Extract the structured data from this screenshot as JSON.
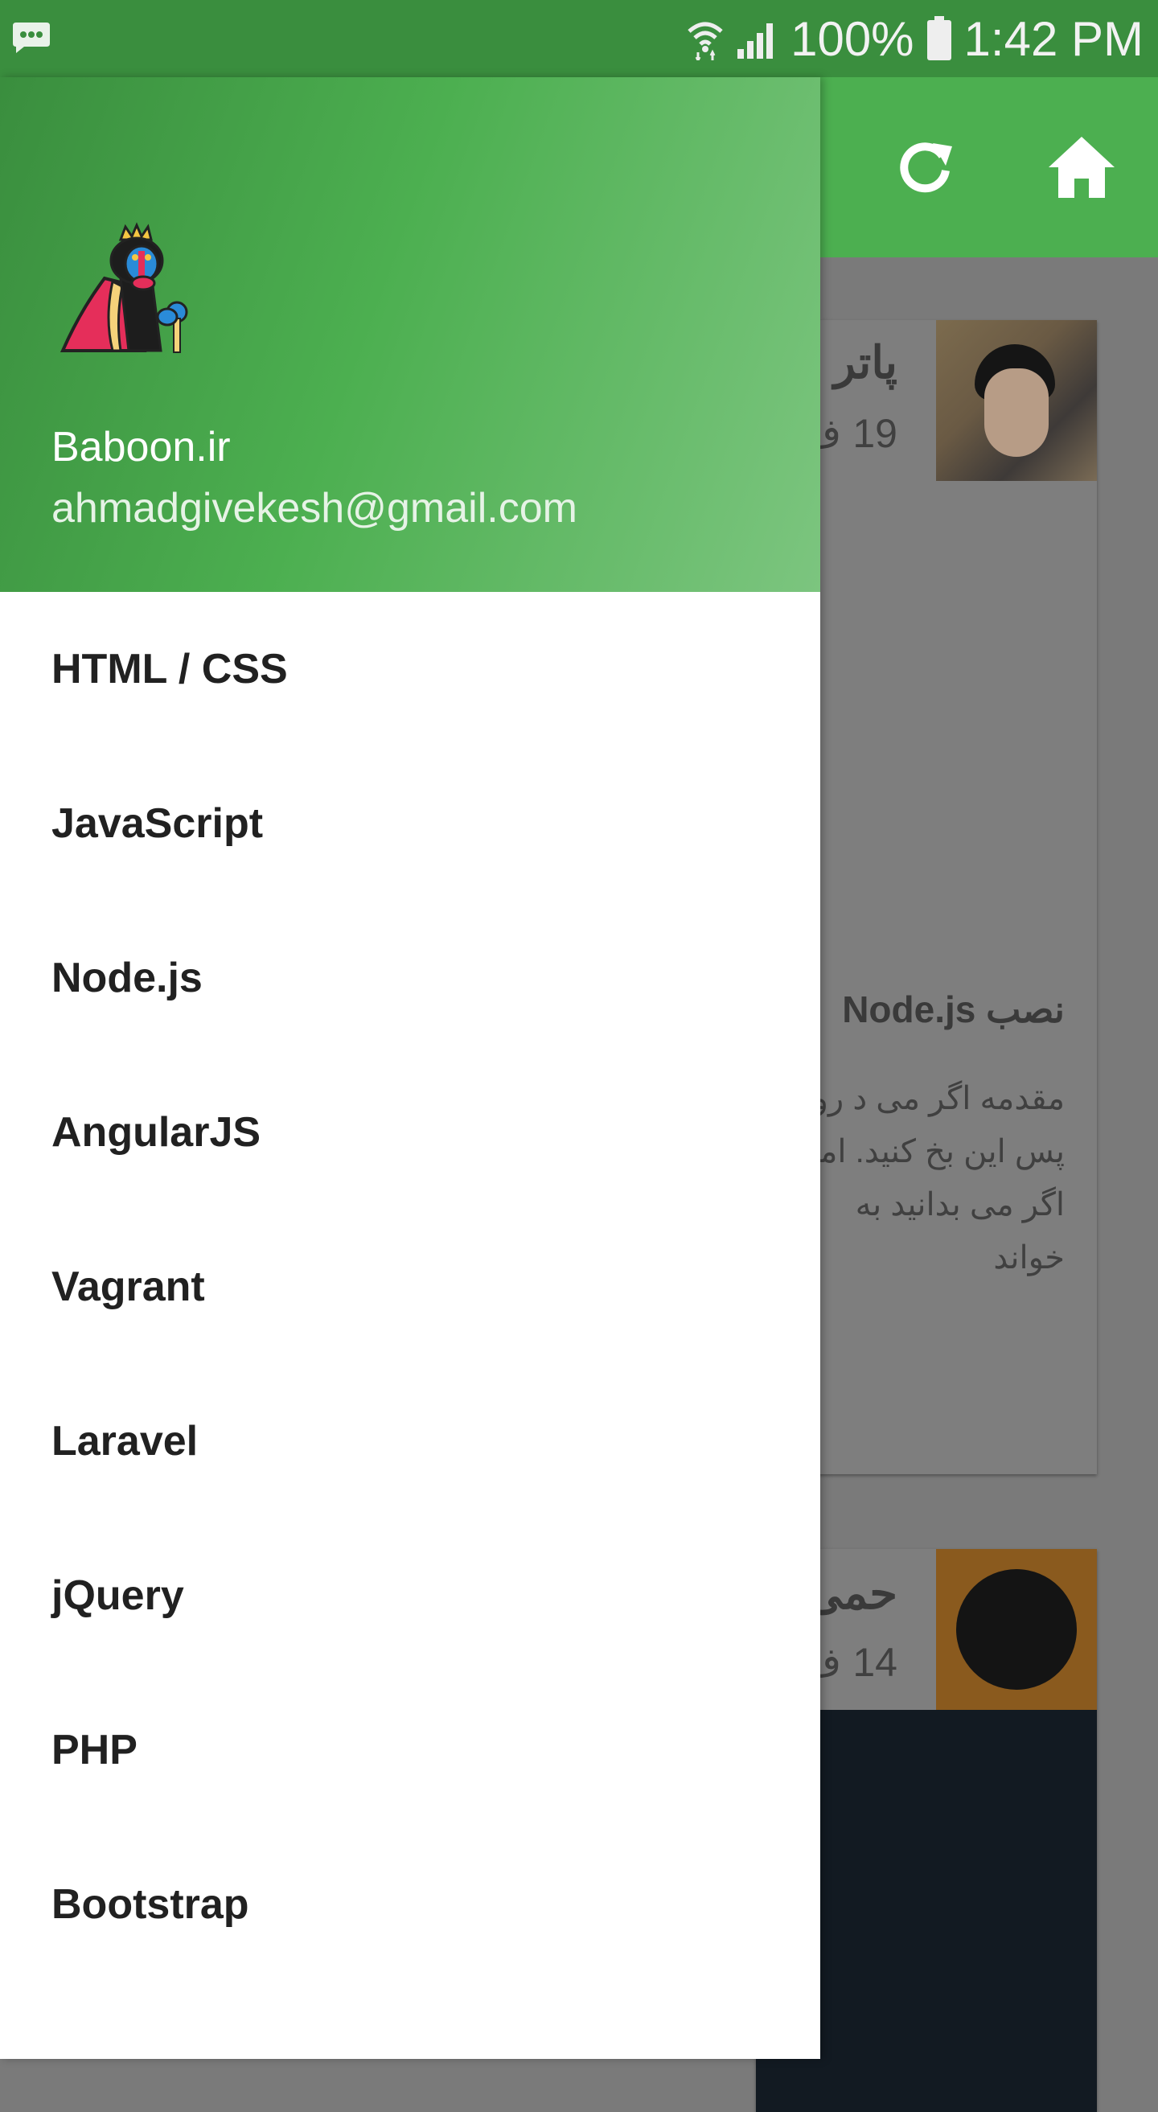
{
  "status_bar": {
    "battery": "100%",
    "time": "1:42 PM",
    "icons": [
      "chat-bubble-icon",
      "wifi-icon",
      "signal-icon",
      "battery-icon"
    ]
  },
  "app_bar": {
    "actions": [
      "refresh-icon",
      "home-icon"
    ],
    "color": "#4caf50"
  },
  "drawer": {
    "header": {
      "logo": "baboon-logo",
      "name": "Baboon.ir",
      "email": "ahmadgivekesh@gmail.com"
    },
    "items": [
      {
        "label": "HTML / CSS"
      },
      {
        "label": "JavaScript"
      },
      {
        "label": "Node.js"
      },
      {
        "label": "AngularJS"
      },
      {
        "label": "Vagrant"
      },
      {
        "label": "Laravel"
      },
      {
        "label": "jQuery"
      },
      {
        "label": "PHP"
      },
      {
        "label": "Bootstrap"
      }
    ]
  },
  "background_content": {
    "cards": [
      {
        "title": "پاتر",
        "date": "19 ف",
        "heading": "نصب Node.js",
        "excerpt": "مقدمه اگر می د رود، پس این بخ کنید. اما اگر می بدانید به خواند"
      },
      {
        "title": "حمی",
        "date": "14 ف"
      }
    ]
  },
  "colors": {
    "status_bar": "#3a8e3e",
    "primary": "#4caf50",
    "primary_light": "#7cc57f",
    "scrim_gray": "#7a7a7a"
  }
}
